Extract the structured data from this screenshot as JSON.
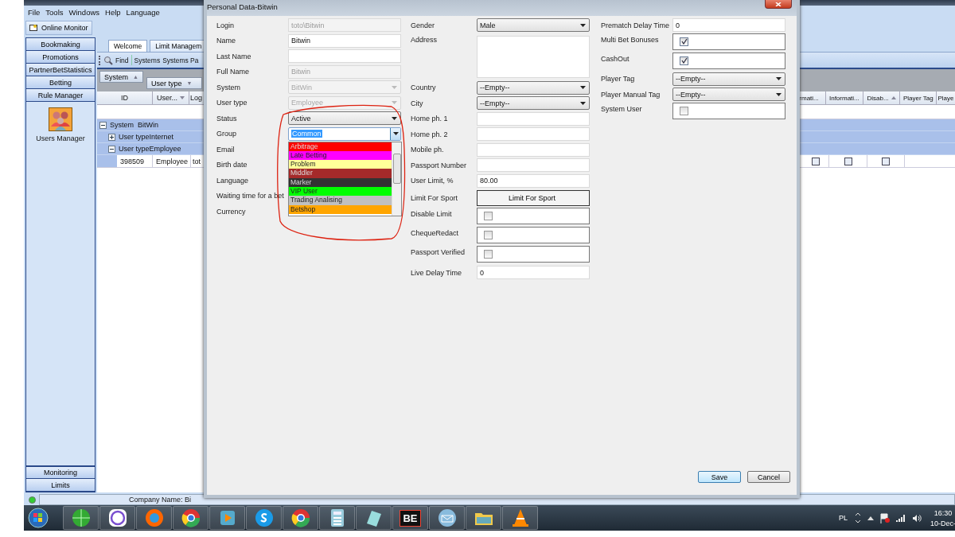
{
  "app": {
    "menu": [
      "File",
      "Tools",
      "Windows",
      "Help",
      "Language"
    ],
    "toolbar_button": "Online Monitor",
    "nav_top": [
      "Bookmaking",
      "Promotions",
      "PartnerBetStatistics",
      "Betting",
      "Rule Manager"
    ],
    "nav_module": "Users Manager",
    "nav_bottom": [
      "Monitoring",
      "Limits"
    ],
    "tabs": [
      {
        "label": "Welcome",
        "selected": true
      },
      {
        "label": "Limit Managem",
        "selected": false
      }
    ],
    "toolbar": [
      "Find",
      "Systems",
      "Systems Pa"
    ],
    "group_by": [
      {
        "label": "System",
        "arrow": "▲"
      },
      {
        "label": "User type",
        "arrow": "▼"
      }
    ],
    "columns_left": [
      "ID",
      "User...",
      "Log"
    ],
    "columns_right": [
      {
        "label": "rmati...",
        "sorted": false
      },
      {
        "label": "Informati...",
        "sorted": false
      },
      {
        "label": "Disab...",
        "sorted": true
      },
      {
        "label": "Player Tag",
        "sorted": false
      },
      {
        "label": "Playe",
        "sorted": false
      }
    ],
    "tree": [
      {
        "label": "System  BitWin",
        "expanded": true,
        "children": [
          {
            "label": "User typeInternet",
            "expanded": false
          },
          {
            "label": "User typeEmployee",
            "expanded": true,
            "rows": [
              {
                "cells": [
                  "398509",
                  "Employee",
                  "tot"
                ],
                "checks": [
                  false,
                  false,
                  false
                ]
              }
            ]
          }
        ]
      }
    ],
    "status": {
      "online": true,
      "company": "Company Name: Bi"
    }
  },
  "dialog": {
    "title": "Personal Data-Bitwin",
    "columns": [
      [
        {
          "kind": "text",
          "label": "Login",
          "value": "toto\\Bitwin",
          "disabled": true
        },
        {
          "kind": "text",
          "label": "Name",
          "value": "Bitwin",
          "disabled": false
        },
        {
          "kind": "text",
          "label": "Last Name",
          "disabled": false
        },
        {
          "kind": "text",
          "label": "Full Name",
          "value": "Bitwin",
          "disabled": true
        },
        {
          "kind": "select",
          "label": "System",
          "value": "BitWin",
          "disabled": true
        },
        {
          "kind": "select",
          "label": "User type",
          "value": "Employee",
          "disabled": true
        },
        {
          "kind": "select",
          "label": "Status",
          "value": "Active",
          "disabled": false
        },
        {
          "kind": "select",
          "label": "Group",
          "value": "Common",
          "disabled": false,
          "open": true,
          "options": [
            {
              "label": "Arbitrage",
              "color": "#ff0000",
              "selected": false
            },
            {
              "label": "Late Betting",
              "color": "#ff00ff",
              "selected": false
            },
            {
              "label": "Problem",
              "color": "#ffff99",
              "selected": false
            },
            {
              "label": "Middler",
              "color": "#a52a2a",
              "selected": false
            },
            {
              "label": "Marker",
              "color": "#333333",
              "selected": false
            },
            {
              "label": "VIP User",
              "color": "#00ff00",
              "selected": false
            },
            {
              "label": "Trading Analising",
              "color": "#c0c0c0",
              "selected": false
            },
            {
              "label": "Betshop",
              "color": "#ffa500",
              "selected": false
            }
          ]
        },
        {
          "kind": "label",
          "label": "Email"
        },
        {
          "kind": "label",
          "label": "Birth date"
        },
        {
          "kind": "label",
          "label": "Language"
        },
        {
          "kind": "label",
          "label": "Waiting time for a bet"
        },
        {
          "kind": "label",
          "label": "Currency"
        }
      ],
      [
        {
          "kind": "select",
          "label": "Gender",
          "value": "Male",
          "disabled": false
        },
        {
          "kind": "textarea",
          "label": "Address"
        },
        {
          "kind": "select",
          "label": "Country",
          "value": "--Empty--",
          "disabled": false
        },
        {
          "kind": "select",
          "label": "City",
          "value": "--Empty--",
          "disabled": false
        },
        {
          "kind": "text",
          "label": "Home ph. 1",
          "disabled": false
        },
        {
          "kind": "text",
          "label": "Home ph. 2",
          "disabled": false
        },
        {
          "kind": "text",
          "label": "Mobile ph.",
          "disabled": false
        },
        {
          "kind": "text",
          "label": "Passport Number",
          "disabled": false
        },
        {
          "kind": "text",
          "label": "User Limit, %",
          "value": "80.00",
          "disabled": false
        },
        {
          "kind": "button",
          "label": "Limit For Sport",
          "value": "Limit For Sport"
        },
        {
          "kind": "check",
          "label": "Disable Limit",
          "checked": false
        },
        {
          "kind": "check",
          "label": "ChequeRedact",
          "checked": false
        },
        {
          "kind": "check",
          "label": "Passport Verified",
          "checked": false
        },
        {
          "kind": "text",
          "label": "Live Delay Time",
          "value": "0",
          "disabled": false
        }
      ],
      [
        {
          "kind": "text",
          "label": "Prematch Delay Time",
          "value": "0",
          "disabled": false
        },
        {
          "kind": "check",
          "label": "Multi Bet Bonuses",
          "checked": true
        },
        {
          "kind": "check",
          "label": "CashOut",
          "checked": true
        },
        {
          "kind": "select",
          "label": "Player Tag",
          "value": "--Empty--",
          "disabled": false
        },
        {
          "kind": "select",
          "label": "Player Manual Tag",
          "value": "--Empty--",
          "disabled": false
        },
        {
          "kind": "check",
          "label": "System User",
          "checked": false
        }
      ]
    ],
    "buttons": [
      "Save",
      "Cancel"
    ]
  },
  "taskbar": {
    "be_label": "BE",
    "language": "PL",
    "time": "16:30",
    "date": "10-Dec-"
  }
}
